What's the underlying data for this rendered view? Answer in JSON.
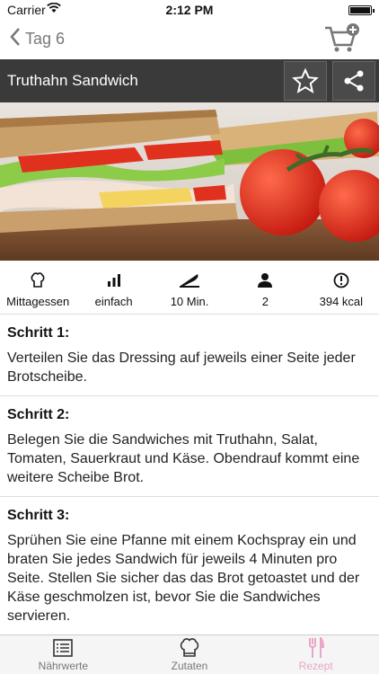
{
  "status_bar": {
    "carrier": "Carrier",
    "time": "2:12 PM"
  },
  "nav": {
    "back_label": "Tag 6"
  },
  "recipe": {
    "title": "Truthahn Sandwich",
    "stats": [
      {
        "icon": "chef-hat-icon",
        "label": "Mittagessen"
      },
      {
        "icon": "bar-chart-icon",
        "label": "einfach"
      },
      {
        "icon": "knife-icon",
        "label": "10 Min."
      },
      {
        "icon": "person-icon",
        "label": "2"
      },
      {
        "icon": "alert-circle-icon",
        "label": "394 kcal"
      }
    ],
    "steps": [
      {
        "title": "Schritt 1:",
        "text": "Verteilen Sie das Dressing auf jeweils einer Seite jeder Brotscheibe."
      },
      {
        "title": "Schritt 2:",
        "text": "Belegen Sie die Sandwiches mit Truthahn, Salat, Tomaten, Sauerkraut und Käse. Obendrauf kommt eine weitere Scheibe Brot."
      },
      {
        "title": "Schritt 3:",
        "text": "Sprühen Sie eine Pfanne mit einem Kochspray ein und braten Sie jedes Sandwich für jeweils 4 Minuten pro Seite. Stellen Sie sicher das das Brot getoastet und der Käse geschmolzen ist, bevor Sie die Sandwiches servieren."
      }
    ]
  },
  "tabbar": {
    "tabs": [
      {
        "label": "Nährwerte",
        "icon": "list-icon"
      },
      {
        "label": "Zutaten",
        "icon": "chef-hat-icon"
      },
      {
        "label": "Rezept",
        "icon": "fork-knife-icon",
        "active": true
      }
    ]
  },
  "colors": {
    "title_bar": "#3a3a3a",
    "active_tab": "#e9a6c6",
    "inactive": "#777777"
  }
}
